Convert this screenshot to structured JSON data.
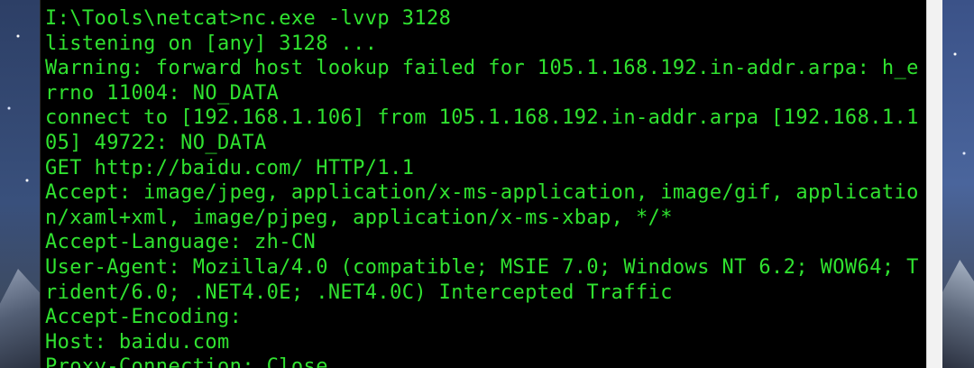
{
  "terminal": {
    "text_color": "#30e230",
    "background_color": "#000000",
    "lines": [
      "I:\\Tools\\netcat>nc.exe -lvvp 3128",
      "listening on [any] 3128 ...",
      "Warning: forward host lookup failed for 105.1.168.192.in-addr.arpa: h_e",
      "rrno 11004: NO_DATA",
      "connect to [192.168.1.106] from 105.1.168.192.in-addr.arpa [192.168.1.1",
      "05] 49722: NO_DATA",
      "GET http://baidu.com/ HTTP/1.1",
      "Accept: image/jpeg, application/x-ms-application, image/gif, applicatio",
      "n/xaml+xml, image/pjpeg, application/x-ms-xbap, */*",
      "Accept-Language: zh-CN",
      "User-Agent: Mozilla/4.0 (compatible; MSIE 7.0; Windows NT 6.2; WOW64; T",
      "rident/6.0; .NET4.0E; .NET4.0C) Intercepted Traffic",
      "Accept-Encoding:",
      "Host: baidu.com",
      "Proxy-Connection: Close"
    ]
  }
}
